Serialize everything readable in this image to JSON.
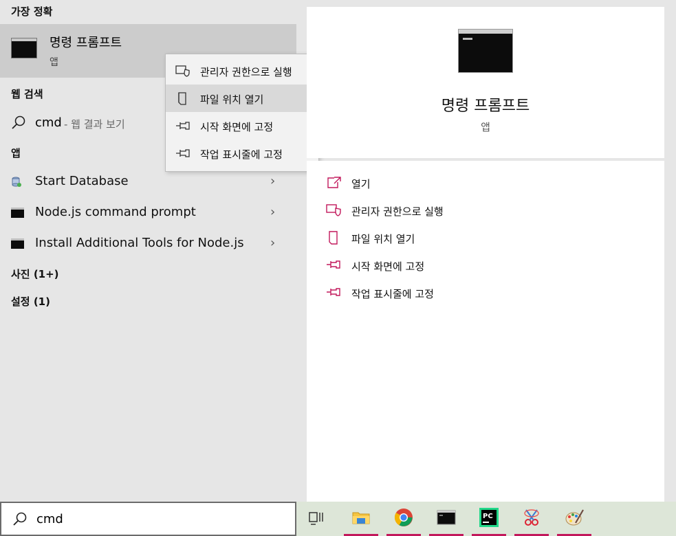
{
  "left": {
    "best_match_title": "가장 정확",
    "best_match": {
      "name": "명령 프롬프트",
      "type": "앱"
    },
    "web_title": "웹 검색",
    "web_query": "cmd",
    "web_hint": "- 웹 결과 보기",
    "apps_title": "앱",
    "apps": [
      {
        "label": "Start Database",
        "icon": "database-icon"
      },
      {
        "label": "Node.js command prompt",
        "icon": "console-icon"
      },
      {
        "label": "Install Additional Tools for Node.js",
        "icon": "console-icon"
      }
    ],
    "photos_title": "사진 (1+)",
    "settings_title": "설정 (1)"
  },
  "context_menu": {
    "items": [
      {
        "label": "관리자 권한으로 실행",
        "icon": "shield-icon"
      },
      {
        "label": "파일 위치 열기",
        "icon": "folder-location-icon",
        "highlighted": true
      },
      {
        "label": "시작 화면에 고정",
        "icon": "pin-icon"
      },
      {
        "label": "작업 표시줄에 고정",
        "icon": "pin-icon"
      }
    ]
  },
  "right": {
    "name": "명령 프롬프트",
    "type": "앱",
    "actions": [
      {
        "label": "열기",
        "icon": "open-icon"
      },
      {
        "label": "관리자 권한으로 실행",
        "icon": "shield-icon"
      },
      {
        "label": "파일 위치 열기",
        "icon": "folder-location-icon"
      },
      {
        "label": "시작 화면에 고정",
        "icon": "pin-icon"
      },
      {
        "label": "작업 표시줄에 고정",
        "icon": "pin-icon"
      }
    ]
  },
  "taskbar": {
    "search_text": "cmd",
    "apps": [
      "task-view-icon",
      "file-explorer-icon",
      "chrome-icon",
      "terminal-icon",
      "pycharm-icon",
      "snipping-icon",
      "paint-icon"
    ]
  },
  "colors": {
    "accent": "#c2185b",
    "left_bg": "#e6e6e6",
    "selected_bg": "#cccccc"
  }
}
